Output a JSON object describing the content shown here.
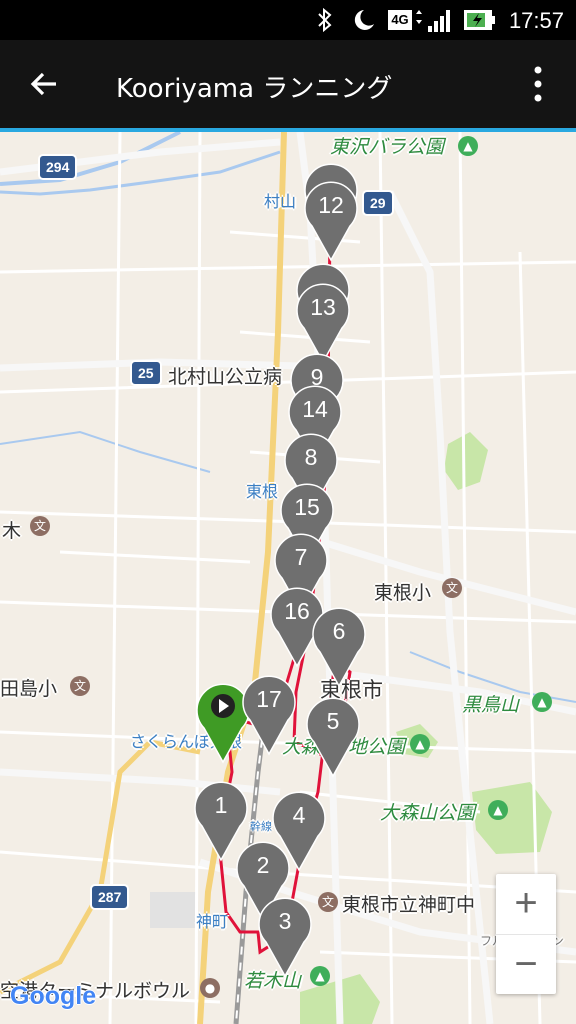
{
  "status_bar": {
    "time": "17:57",
    "icons": [
      "bluetooth-icon",
      "do-not-disturb-moon-icon",
      "network-4g-icon",
      "signal-icon",
      "battery-charging-icon"
    ],
    "network_label": "4G"
  },
  "app_bar": {
    "title": "Kooriyama ランニング",
    "back_icon": "arrow-left-icon",
    "menu_icon": "more-vert-icon",
    "accent_color": "#29a8e0"
  },
  "map": {
    "labels": {
      "higashizawa_bara": "東沢バラ公園",
      "murayama": "村山",
      "kitamurayama_hospital": "北村山公立病",
      "higashine_station": "東根",
      "ki": "木",
      "higashine_elem": "東根小",
      "tajima_elem": "田島小",
      "higashine_city": "東根市",
      "kurotoriyama": "黒鳥山",
      "sakuranbo_station": "さくらんぼ東根",
      "omoriyama_area": "大森",
      "omoriyama_pond": "地公園",
      "omoriyama_park": "大森山公園",
      "jinmachi_jhs": "東根市立神町中",
      "jinmachi": "神町",
      "wakagi": "若木山",
      "bowling": "空港ターミナルボウル",
      "fruit_line": "フルーツライン",
      "line_mark": "幹線"
    },
    "road_shields": [
      "294",
      "29",
      "25",
      "287"
    ],
    "route_color": "#e0123a",
    "start_marker_color": "#3f9b25",
    "waypoint_color": "#6f6f6f",
    "markers": [
      "12",
      "13",
      "9",
      "14",
      "8",
      "15",
      "7",
      "16",
      "6",
      "17",
      "5",
      "1",
      "4",
      "2",
      "3"
    ]
  },
  "zoom": {
    "in": "+",
    "out": "−"
  },
  "attribution": {
    "google": "Google"
  }
}
